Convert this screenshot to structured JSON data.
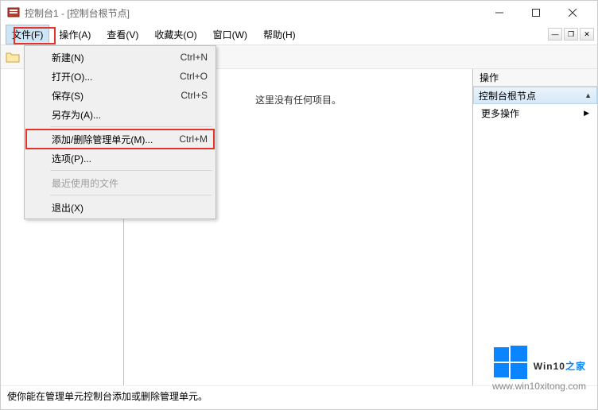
{
  "title": "控制台1 - [控制台根节点]",
  "menubar": {
    "file": "文件(F)",
    "action": "操作(A)",
    "view": "查看(V)",
    "favorites": "收藏夹(O)",
    "window": "窗口(W)",
    "help": "帮助(H)"
  },
  "dropdown": {
    "new": {
      "label": "新建(N)",
      "shortcut": "Ctrl+N"
    },
    "open": {
      "label": "打开(O)...",
      "shortcut": "Ctrl+O"
    },
    "save": {
      "label": "保存(S)",
      "shortcut": "Ctrl+S"
    },
    "saveas": {
      "label": "另存为(A)...",
      "shortcut": ""
    },
    "addremove": {
      "label": "添加/删除管理单元(M)...",
      "shortcut": "Ctrl+M"
    },
    "options": {
      "label": "选项(P)...",
      "shortcut": ""
    },
    "recent": {
      "label": "最近使用的文件",
      "shortcut": ""
    },
    "exit": {
      "label": "退出(X)",
      "shortcut": ""
    }
  },
  "main": {
    "empty": "这里没有任何项目。"
  },
  "actions": {
    "header": "操作",
    "section": "控制台根节点",
    "more": "更多操作"
  },
  "statusbar": "使你能在管理单元控制台添加或删除管理单元。",
  "watermark": {
    "brand_pre": "Win10",
    "brand_post": "之家",
    "url": "www.win10xitong.com"
  }
}
